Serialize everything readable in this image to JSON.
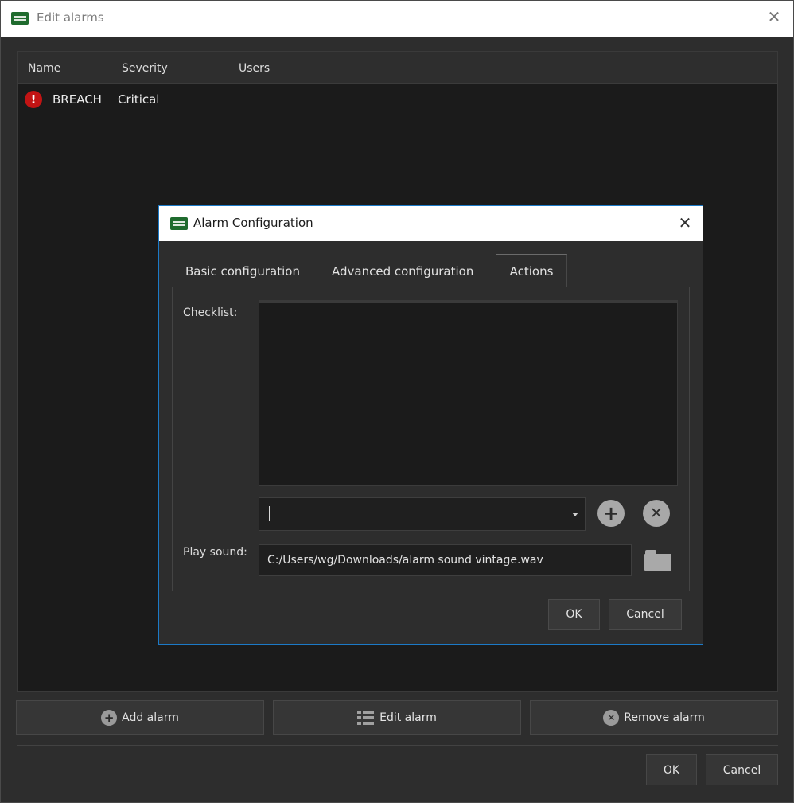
{
  "window": {
    "title": "Edit alarms",
    "close_glyph": "✕"
  },
  "table": {
    "columns": [
      "Name",
      "Severity",
      "Users"
    ],
    "rows": [
      {
        "icon": "critical-alert-icon",
        "severity_glyph": "!",
        "name": "BREACH",
        "severity": "Critical",
        "users": ""
      }
    ]
  },
  "buttons": {
    "add_alarm": "Add alarm",
    "edit_alarm": "Edit alarm",
    "remove_alarm": "Remove alarm",
    "ok": "OK",
    "cancel": "Cancel",
    "add_glyph": "+",
    "remove_glyph": "✕"
  },
  "dialog": {
    "title": "Alarm Configuration",
    "close_glyph": "✕",
    "tabs": [
      {
        "label": "Basic configuration",
        "active": false
      },
      {
        "label": "Advanced configuration",
        "active": false
      },
      {
        "label": "Actions",
        "active": true
      }
    ],
    "checklist_label": "Checklist:",
    "checklist_input_value": "",
    "add_item_glyph": "+",
    "remove_item_glyph": "✕",
    "play_sound_label": "Play sound:",
    "sound_path": "C:/Users/wg/Downloads/alarm sound vintage.wav",
    "ok": "OK",
    "cancel": "Cancel"
  },
  "colors": {
    "critical": "#c21414",
    "dialog_border": "#1c7ac7",
    "app_icon": "#1f6b2e"
  }
}
